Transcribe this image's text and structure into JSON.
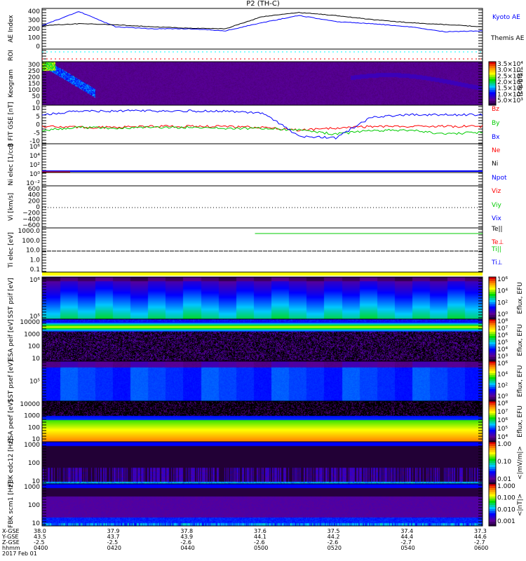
{
  "title": "P2 (TH-C)",
  "colors": {
    "blue": "#0000ff",
    "red": "#ff0000",
    "green": "#00cc00",
    "black": "#000000",
    "yellow": "#ffff00",
    "cyan": "#00ffff"
  },
  "chart_data": {
    "type": "line",
    "title": "P2 (TH-C)",
    "time_range": [
      "0400",
      "0600"
    ],
    "x_minutes": [
      0,
      10,
      20,
      30,
      40,
      50,
      60,
      70,
      80,
      90,
      100,
      110,
      120
    ],
    "panels": [
      {
        "id": "ae",
        "ylabel": "AE Index",
        "yticks": [
          "400",
          "300",
          "200",
          "100",
          "0"
        ],
        "ylim": [
          0,
          400
        ],
        "series": [
          {
            "name": "Kyoto AE",
            "color": "#0000ff",
            "values": [
              230,
              370,
              220,
              200,
              200,
              180,
              260,
              330,
              270,
              250,
              220,
              170,
              180
            ]
          },
          {
            "name": "Themis AE",
            "color": "#000000",
            "values": [
              230,
              250,
              240,
              220,
              205,
              200,
              320,
              360,
              330,
              290,
              260,
              240,
              220
            ]
          }
        ]
      },
      {
        "id": "roi",
        "ylabel": "ROI"
      },
      {
        "id": "keogram",
        "ylabel": "Keogram",
        "yticks": [
          "300",
          "250",
          "200",
          "150",
          "100",
          "50",
          "0"
        ],
        "colorbar": [
          "3.5×10⁴",
          "3.0×10⁴",
          "2.5×10⁴",
          "2.0×10⁴",
          "1.5×10⁴",
          "1.0×10⁴",
          "5.0×10³"
        ],
        "colorbar_label": "[counts]"
      },
      {
        "id": "bfit",
        "ylabel": "B FIT GSE [nT]",
        "yticks": [
          "10",
          "5",
          "0",
          "-5",
          "-10"
        ],
        "ylim": [
          -10,
          10
        ],
        "series": [
          {
            "name": "Bz",
            "color": "#ff0000",
            "values": [
              -1,
              -1.5,
              -1.5,
              -1,
              -1,
              -1,
              -1.5,
              -3,
              -2,
              -1,
              -1,
              -1,
              -1
            ]
          },
          {
            "name": "By",
            "color": "#00cc00",
            "values": [
              -3,
              -1.5,
              -2,
              -1.5,
              -1.5,
              -2,
              -2,
              -3,
              -5,
              -3,
              -3,
              -5,
              -4
            ]
          },
          {
            "name": "Bx",
            "color": "#0000ff",
            "values": [
              5,
              7,
              7,
              7,
              7,
              7,
              6,
              -6,
              -7,
              4,
              5,
              5,
              5
            ]
          }
        ]
      },
      {
        "id": "ni",
        "ylabel": "Ni elec [1/cc]",
        "yticks": [
          "10⁶",
          "10⁴",
          "10²",
          "10⁰",
          "10⁻²"
        ],
        "legend": [
          "Ne",
          "Ni",
          "Npot"
        ]
      },
      {
        "id": "vi",
        "ylabel": "Vi [km/s]",
        "yticks": [
          "600",
          "400",
          "200",
          "0",
          "−200",
          "−400",
          "−600"
        ],
        "legend": [
          "Viz",
          "Viy",
          "Vix"
        ]
      },
      {
        "id": "t",
        "ylabel": "Ti elec [eV]",
        "yticks": [
          "1000.0",
          "100.0",
          "10.0",
          "1.0",
          "0.1"
        ],
        "legend": [
          "Te||",
          "Te⊥",
          "Ti||",
          "Ti⊥"
        ]
      },
      {
        "id": "sst_i",
        "ylabel": "SST psif [eV]",
        "yticks": [
          "10⁶",
          "10⁵"
        ],
        "colorbar": [
          "10⁶",
          "10⁴",
          "10²",
          "10⁰"
        ],
        "colorbar_label": "Eflux, EFU"
      },
      {
        "id": "esa_i",
        "ylabel": "ESA peif [eV]",
        "yticks": [
          "10000",
          "1000",
          "100",
          "10"
        ],
        "colorbar": [
          "10⁸",
          "10⁷",
          "10⁶",
          "10⁵",
          "10⁴",
          "10³"
        ],
        "colorbar_label": "Eflux, EFU"
      },
      {
        "id": "sst_e",
        "ylabel": "SST psef [eV]",
        "yticks": [
          "10⁵"
        ],
        "colorbar": [
          "10⁶",
          "10⁴",
          "10²",
          "10⁰"
        ],
        "colorbar_label": "Eflux, EFU"
      },
      {
        "id": "esa_e",
        "ylabel": "ESA peef [eV]",
        "yticks": [
          "10000",
          "1000",
          "100",
          "10"
        ],
        "colorbar": [
          "10⁸",
          "10⁷",
          "10⁶",
          "10⁵",
          "10⁴"
        ],
        "colorbar_label": "Eflux, EFU"
      },
      {
        "id": "fbk1",
        "ylabel": "FBK edc12 [Hz]",
        "yticks": [
          "1000",
          "100",
          "10"
        ],
        "colorbar": [
          "1.00",
          "0.10",
          "0.01"
        ],
        "colorbar_label": "<|mV/m|>"
      },
      {
        "id": "fbk2",
        "ylabel": "FBK scm1 [Hz]",
        "yticks": [
          "1000",
          "100",
          "10"
        ],
        "colorbar": [
          "1.000",
          "0.100",
          "0.010",
          "0.001"
        ],
        "colorbar_label": "<|nT|>"
      }
    ]
  },
  "legend": {
    "kyoto": "Kyoto AE",
    "themis": "Themis AE",
    "bz": "Bz",
    "by": "By",
    "bx": "Bx",
    "ne": "Ne",
    "ni": "Ni",
    "npot": "Npot",
    "viz": "Viz",
    "viy": "Viy",
    "vix": "Vix",
    "tell": "Te||",
    "teperp": "Te⊥",
    "tipar": "Ti||",
    "tiperp": "Ti⊥"
  },
  "footer": {
    "row_labels": [
      "X-GSE",
      "Y-GSE",
      "Z-GSE",
      "hhmm"
    ],
    "date": "2017 Feb 01",
    "columns": [
      [
        "38.0",
        "43.5",
        "-2.5",
        "0400"
      ],
      [
        "37.9",
        "43.7",
        "-2.5",
        "0420"
      ],
      [
        "37.8",
        "43.9",
        "-2.6",
        "0440"
      ],
      [
        "37.6",
        "44.1",
        "-2.6",
        "0500"
      ],
      [
        "37.5",
        "44.2",
        "-2.6",
        "0520"
      ],
      [
        "37.4",
        "44.4",
        "-2.7",
        "0540"
      ],
      [
        "37.3",
        "44.6",
        "-2.7",
        "0600"
      ]
    ]
  }
}
